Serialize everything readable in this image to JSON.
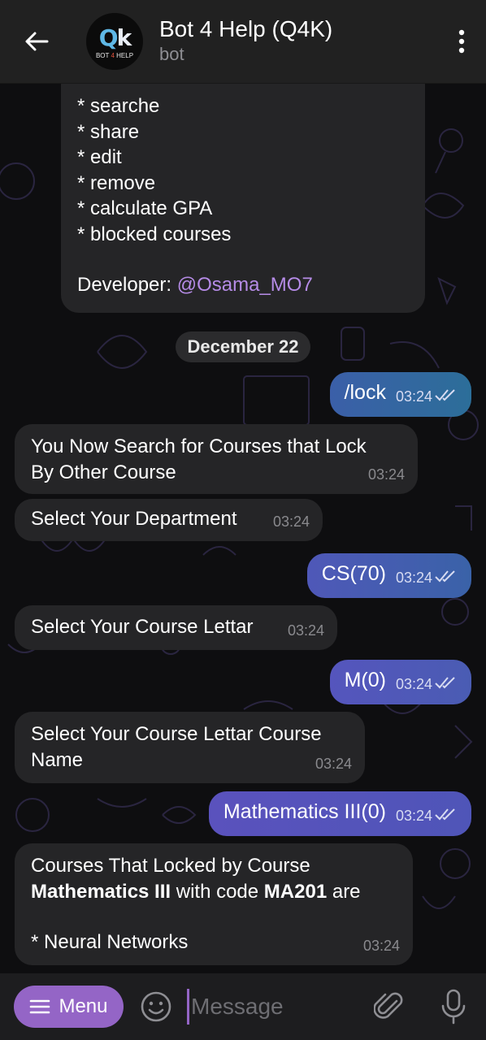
{
  "header": {
    "title": "Bot 4 Help (Q4K)",
    "subtitle": "bot",
    "avatar_logo_q": "Q",
    "avatar_logo_k": "k",
    "avatar_brand_left": "BOT ",
    "avatar_brand_mid": "4",
    "avatar_brand_right": " HELP"
  },
  "first_message": {
    "lines": [
      "* searche",
      "* share",
      "* edit",
      "* remove",
      "* calculate GPA",
      "* blocked courses"
    ],
    "developer_label": "Developer: ",
    "developer_handle": "@Osama_MO7"
  },
  "date_separator": "December 22",
  "messages": [
    {
      "dir": "out",
      "text": "/lock",
      "time": "03:24"
    },
    {
      "dir": "in",
      "text": "You Now Search for Courses that Lock By Other Course",
      "time": "03:24"
    },
    {
      "dir": "in",
      "text": "Select Your Department",
      "time": "03:24"
    },
    {
      "dir": "out",
      "text": "CS(70)",
      "time": "03:24"
    },
    {
      "dir": "in",
      "text": "Select Your Course Lettar",
      "time": "03:24"
    },
    {
      "dir": "out",
      "text": "M(0)",
      "time": "03:24"
    },
    {
      "dir": "in",
      "text": "Select Your Course Lettar Course Name",
      "time": "03:24"
    },
    {
      "dir": "out",
      "text": "Mathematics III(0)",
      "time": "03:24"
    }
  ],
  "last_message": {
    "line1": "Courses That Locked by Course",
    "bold_course": "Mathematics III",
    "mid": " with code ",
    "bold_code": "MA201",
    "end": " are",
    "item": "* Neural Networks",
    "time": "03:24"
  },
  "composer": {
    "menu_label": "Menu",
    "placeholder": "Message"
  },
  "colors": {
    "header_bg": "#212121",
    "incoming_bubble": "#252527",
    "outgoing_gradient_start": "#6b52c4",
    "outgoing_gradient_end": "#2d6f9a",
    "menu_button": "#9465c6",
    "link": "#b58be6"
  },
  "icons": [
    "back-arrow-icon",
    "more-vertical-icon",
    "read-ticks-icon",
    "menu-lines-icon",
    "emoji-icon",
    "attach-icon",
    "mic-icon"
  ]
}
